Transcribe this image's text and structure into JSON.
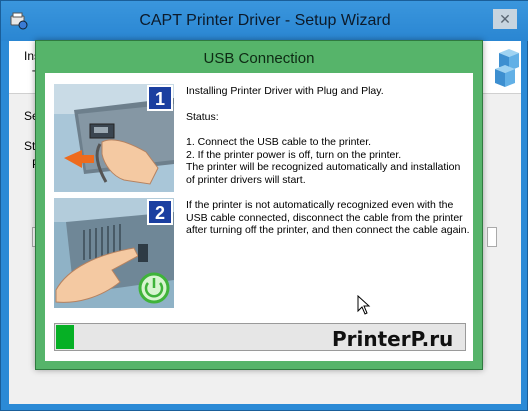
{
  "outer_window": {
    "title": "CAPT Printer Driver - Setup Wizard",
    "close_glyph": "✕",
    "header_line1": "Insta",
    "header_line2": "T",
    "label1": "Se",
    "label2": "Sta",
    "label3": "P"
  },
  "dialog": {
    "title": "USB Connection",
    "intro": "Installing Printer Driver with Plug and Play.",
    "status_label": "Status:",
    "step1": "1. Connect the USB cable to the printer.",
    "step2": "2. If the printer power is off, turn on the printer.",
    "step3": "The printer will be recognized automatically and installation of printer drivers will start.",
    "note": "If the printer is not automatically recognized even with the USB cable connected, disconnect the cable from the printer after turning off the printer, and then connect the cable again.",
    "step_badges": [
      "1",
      "2"
    ],
    "progress_fraction": 0.045,
    "watermark": "PrinterP.ru"
  },
  "icons": {
    "app": "setup-app-icon",
    "cubes": "cubes-icon",
    "usb_illustration": "usb-plug-illustration",
    "power_illustration": "power-button-illustration",
    "power_symbol": "power-icon",
    "cursor": "mouse-cursor-icon"
  },
  "colors": {
    "outer_frame": "#2b8ad6",
    "dialog_frame": "#56b46a",
    "progress_fill": "#06b025",
    "badge_blue": "#1b3fa0"
  }
}
